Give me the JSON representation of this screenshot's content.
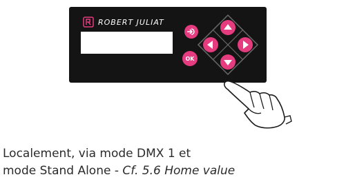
{
  "device": {
    "brand": "ROBERT JULIAT",
    "ok_label": "OK",
    "accent_color": "#e43c7e",
    "panel_color": "#141414",
    "icons": {
      "logo": "robert-juliat-logo-icon",
      "enter": "enter-arrow-icon",
      "up": "arrow-up-icon",
      "down": "arrow-down-icon",
      "left": "arrow-left-icon",
      "right": "arrow-right-icon",
      "hand": "pointing-hand-icon"
    }
  },
  "caption": {
    "line1": "Localement, via mode DMX 1 et",
    "line2": "mode Stand Alone - ",
    "line2_ref": "Cf. 5.6 Home value"
  }
}
